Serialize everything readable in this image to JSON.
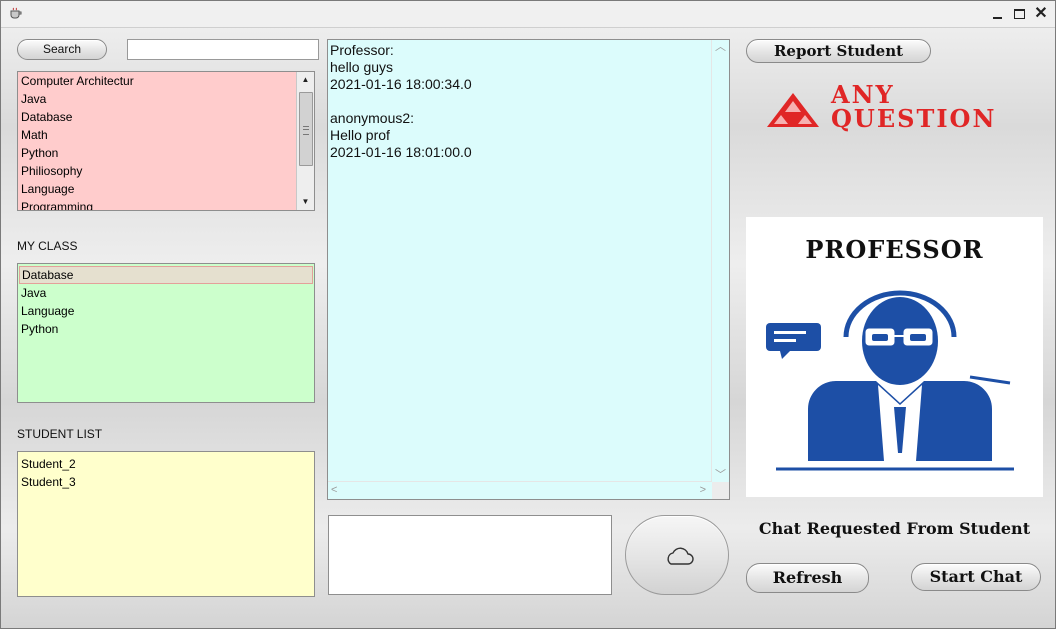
{
  "colors": {
    "course_list_bg": "#ffcccc",
    "class_list_bg": "#ccffcc",
    "student_list_bg": "#ffffcc",
    "chat_bg": "#dcfcfc",
    "logo_red": "#e02626",
    "professor_blue": "#1d4fa6"
  },
  "window": {
    "minimize_icon": "minimize-icon",
    "maximize_icon": "maximize-icon",
    "close_glyph": "✕"
  },
  "search": {
    "button_label": "Search",
    "input_value": "",
    "placeholder": ""
  },
  "courses": {
    "items": [
      "Computer Architectur",
      "Java",
      "Database",
      "Math",
      "Python",
      "Philiosophy",
      "Language",
      "Programming"
    ]
  },
  "my_class": {
    "label": "MY CLASS",
    "items": [
      "Database",
      "Java",
      "Language",
      "Python"
    ],
    "selected_index": 0
  },
  "student_list": {
    "label": "STUDENT LIST",
    "items": [
      "Student_2",
      "Student_3"
    ]
  },
  "chat": {
    "transcript": "Professor:\nhello guys\n2021-01-16 18:00:34.0\n\nanonymous2:\nHello prof\n2021-01-16 18:01:00.0",
    "messages": [
      {
        "sender": "Professor:",
        "text": "hello guys",
        "time": "2021-01-16 18:00:34.0"
      },
      {
        "sender": "anonymous2:",
        "text": "Hello prof",
        "time": "2021-01-16 18:01:00.0"
      }
    ]
  },
  "composer": {
    "value": "",
    "send_icon": "cloud-icon"
  },
  "right_panel": {
    "report_label": "Report Student",
    "logo_line1": "ANY",
    "logo_line2": "QUESTION",
    "professor_title": "PROFESSOR",
    "chat_request_text": "Chat Requested From Student",
    "refresh_label": "Refresh",
    "start_chat_label": "Start Chat"
  }
}
